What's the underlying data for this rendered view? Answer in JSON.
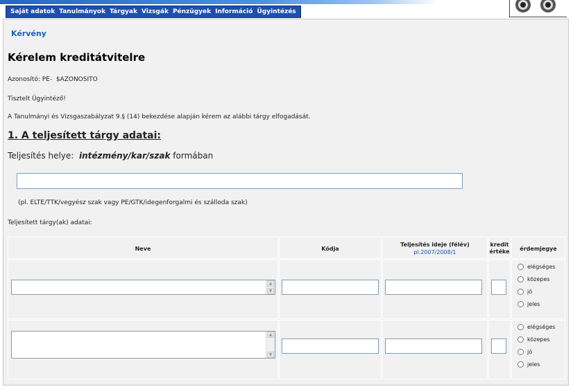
{
  "nav": {
    "items": [
      "Saját adatok",
      "Tanulmányok",
      "Tárgyak",
      "Vizsgák",
      "Pénzügyek",
      "Információ",
      "Ügyintézés"
    ]
  },
  "page": {
    "breadcrumb": "Kérvény",
    "title": "Kérelem kreditátvitelre",
    "id_label": "Azonosító: PE-",
    "id_value": "$AZONOSITO",
    "greeting": "Tisztelt Ügyintéző!",
    "request": "A Tanulmányi és Vizsgaszabályzat 9.§ (14) bekezdése alapján kérem az alábbi tárgy elfogadását.",
    "section_title": "1. A teljesített tárgy adatai:",
    "place_label_pre": "Teljesítés helye:",
    "place_label_bold": "intézmény/kar/szak",
    "place_label_post": "formában",
    "place_hint": "(pl. ELTE/TTK/vegyész szak vagy PE/GTK/idegenforgalmi és szálloda szak)",
    "subjects_label": "Teljesített tárgy(ak) adatai:"
  },
  "table": {
    "headers": {
      "name": "Neve",
      "code": "Kódja",
      "time": "Teljesítés ideje (félév)",
      "time_example": "pl.2007/2008/1",
      "credit_line1": "kredit",
      "credit_line2": "értéke",
      "grade": "érdemjegye"
    },
    "grade_options": [
      "elégséges",
      "közepes",
      "jó",
      "jeles"
    ]
  }
}
